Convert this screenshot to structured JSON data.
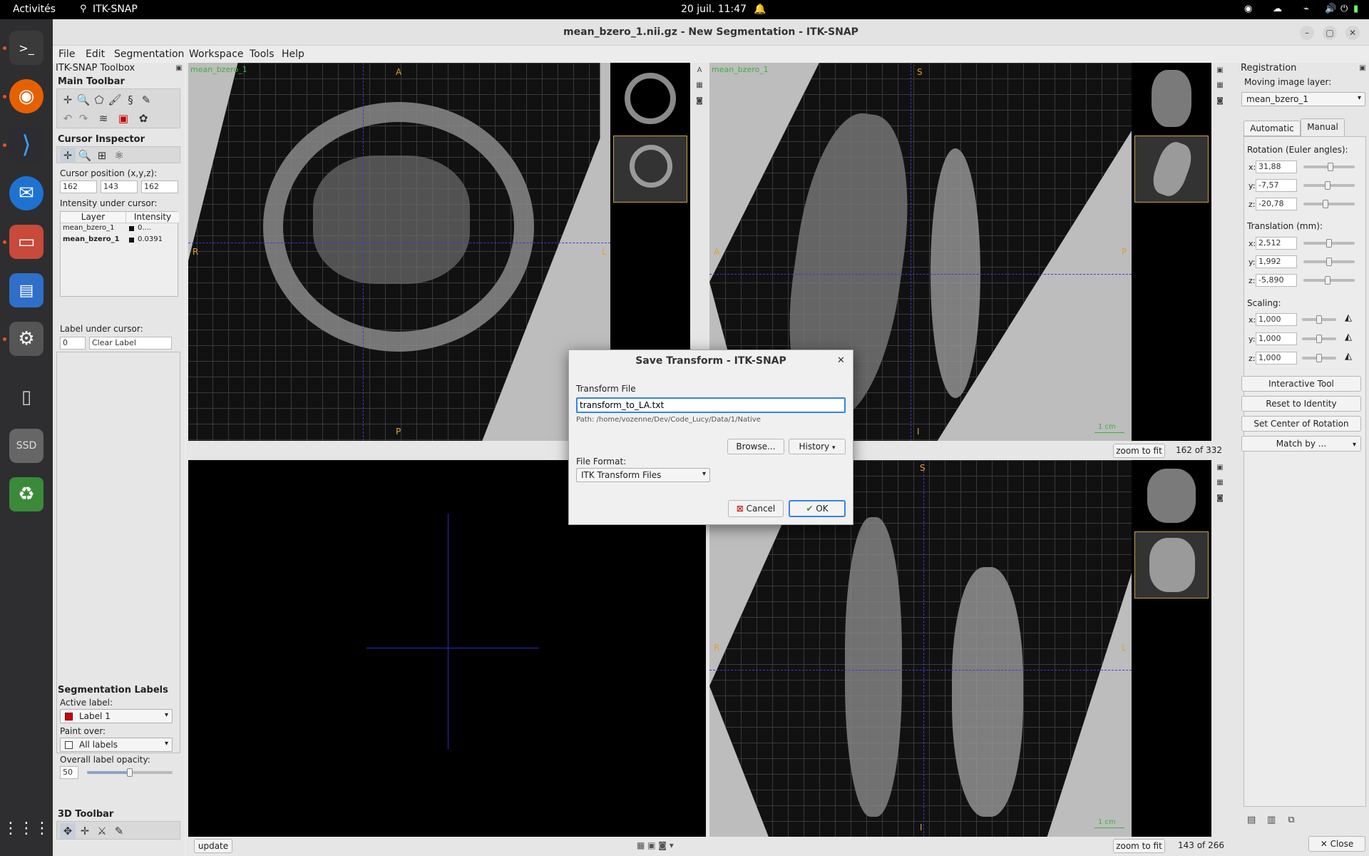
{
  "topbar": {
    "activities": "Activités",
    "app": "ITK-SNAP",
    "datetime": "20 juil.  11:47"
  },
  "window": {
    "title": "mean_bzero_1.nii.gz - New Segmentation - ITK-SNAP"
  },
  "menu": [
    "File",
    "Edit",
    "Segmentation",
    "Workspace",
    "Tools",
    "Help"
  ],
  "left": {
    "toolbox_title": "ITK-SNAP Toolbox",
    "main_toolbar": "Main Toolbar",
    "cursor_inspector": "Cursor Inspector",
    "cursor_position_label": "Cursor position (x,y,z):",
    "cursor_pos": [
      "162",
      "143",
      "162"
    ],
    "intensity_label": "Intensity under cursor:",
    "table_headers": [
      "Layer",
      "Intensity"
    ],
    "layers": [
      {
        "name": "mean_bzero_1",
        "value": "0...."
      },
      {
        "name": "mean_bzero_1",
        "value": "0.0391"
      }
    ],
    "label_under_cursor": "Label under cursor:",
    "label_value": "0",
    "label_name": "Clear Label",
    "seg_labels": "Segmentation Labels",
    "active_label_lbl": "Active label:",
    "active_label": "Label 1",
    "paint_over_lbl": "Paint over:",
    "paint_over": "All labels",
    "opacity_lbl": "Overall label opacity:",
    "opacity": "50",
    "toolbar3d": "3D Toolbar",
    "update": "update"
  },
  "views": {
    "axial": {
      "name": "mean_bzero_1",
      "top": "A",
      "bottom": "P",
      "left": "R",
      "right": "L"
    },
    "sagittal": {
      "name": "mean_bzero_1",
      "top": "S",
      "bottom": "I",
      "left": "A",
      "right": "P",
      "scale": "1 cm",
      "zoom": "zoom to fit",
      "slice": "162 of 332"
    },
    "coronal": {
      "top": "S",
      "bottom": "I",
      "left": "R",
      "right": "L",
      "scale": "1 cm",
      "zoom": "zoom to fit",
      "slice": "143 of 266"
    }
  },
  "right": {
    "title": "Registration",
    "moving_label": "Moving image layer:",
    "moving_layer": "mean_bzero_1",
    "tabs": [
      "Automatic",
      "Manual"
    ],
    "rotation_title": "Rotation (Euler angles):",
    "rotation": {
      "x": "31,88",
      "y": "-7,57",
      "z": "-20,78"
    },
    "translation_title": "Translation (mm):",
    "translation": {
      "x": "2,512",
      "y": "1,992",
      "z": "-5,890"
    },
    "scaling_title": "Scaling:",
    "scaling": {
      "x": "1,000",
      "y": "1,000",
      "z": "1,000"
    },
    "axis": [
      "x:",
      "y:",
      "z:"
    ],
    "buttons": [
      "Interactive Tool",
      "Reset to Identity",
      "Set Center of Rotation",
      "Match by ..."
    ],
    "close": "Close"
  },
  "dialog": {
    "title": "Save Transform - ITK-SNAP",
    "file_label": "Transform File",
    "file_value": "transform_to_LA.txt",
    "path": "Path: /home/vozenne/Dev/Code_Lucy/Data/1/Native",
    "browse": "Browse...",
    "history": "History",
    "format_label": "File Format:",
    "format_value": "ITK Transform Files",
    "cancel": "Cancel",
    "ok": "OK"
  }
}
